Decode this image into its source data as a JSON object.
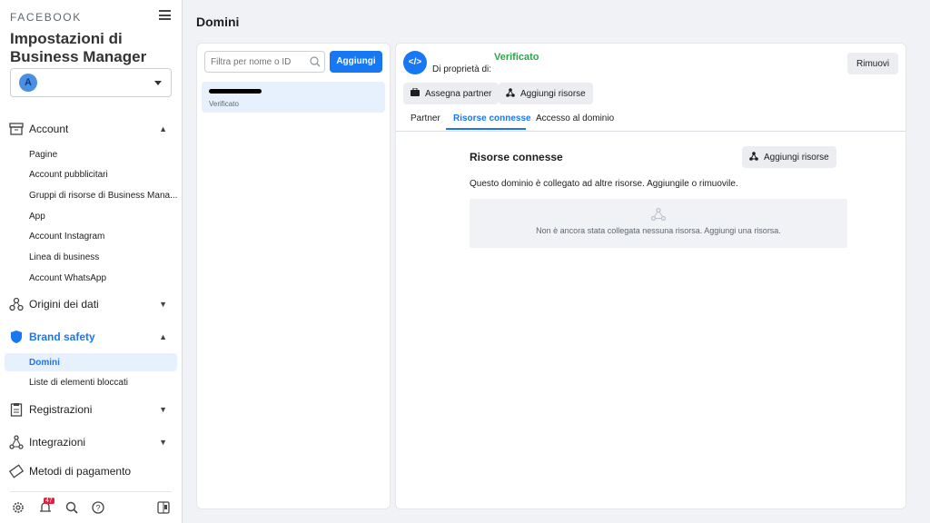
{
  "sidebar": {
    "brand": "FACEBOOK",
    "title": "Impostazioni di Business Manager",
    "account_initial": "A",
    "sections": {
      "account": "Account",
      "origini": "Origini dei dati",
      "brand_safety": "Brand safety",
      "registrazioni": "Registrazioni",
      "integrazioni": "Integrazioni",
      "pagamento": "Metodi di pagamento"
    },
    "account_items": [
      "Pagine",
      "Account pubblicitari",
      "Gruppi di risorse di Business Mana...",
      "App",
      "Account Instagram",
      "Linea di business",
      "Account WhatsApp"
    ],
    "brand_items": [
      "Domini",
      "Liste di elementi bloccati"
    ],
    "notification_count": "47"
  },
  "page": {
    "title": "Domini"
  },
  "list": {
    "search_placeholder": "Filtra per nome o ID",
    "add_label": "Aggiungi",
    "items": [
      {
        "status": "Verificato"
      }
    ]
  },
  "detail": {
    "status": "Verificato",
    "owner_label": "Di proprietà di:",
    "remove_label": "Rimuovi",
    "assign_partner": "Assegna partner",
    "add_resources": "Aggiungi risorse",
    "tabs": [
      "Partner",
      "Risorse connesse",
      "Accesso al dominio"
    ],
    "active_tab": "Risorse connesse",
    "section_title": "Risorse connesse",
    "section_add": "Aggiungi risorse",
    "description": "Questo dominio è collegato ad altre risorse. Aggiungile o rimuovile.",
    "empty": "Non è ancora stata collegata nessuna risorsa. Aggiungi una risorsa."
  },
  "colors": {
    "accent": "#1877f2",
    "verified": "#31a24c",
    "badge": "#e41e3f"
  }
}
